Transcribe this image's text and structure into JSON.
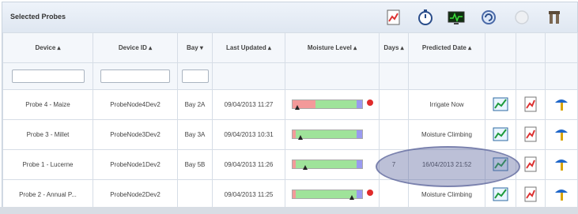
{
  "panel": {
    "title": "Selected Probes"
  },
  "toolbar": {
    "icons": [
      "chart-icon",
      "stopwatch-icon",
      "monitor-icon",
      "refresh-icon",
      "circle-icon",
      "tools-icon"
    ]
  },
  "columns": {
    "device": "Device ▴",
    "device_id": "Device ID ▴",
    "bay": "Bay ▾",
    "last_updated": "Last Updated ▴",
    "moisture": "Moisture Level ▴",
    "days": "Days ▴",
    "predicted": "Predicted Date ▴"
  },
  "rows": [
    {
      "device": "Probe 4 - Maize",
      "device_id": "ProbeNode4Dev2",
      "bay": "Bay 2A",
      "last_updated": "09/04/2013 11:27",
      "days": "",
      "predicted": "Irrigate Now",
      "moisture": {
        "level": 0.07,
        "red_fraction": 0.33,
        "warning": true
      }
    },
    {
      "device": "Probe 3 - Millet",
      "device_id": "ProbeNode3Dev2",
      "bay": "Bay 3A",
      "last_updated": "09/04/2013 10:31",
      "days": "",
      "predicted": "Moisture Climbing",
      "moisture": {
        "level": 0.11,
        "red_fraction": 0.05,
        "warning": false
      }
    },
    {
      "device": "Probe 1 - Lucerne",
      "device_id": "ProbeNode1Dev2",
      "bay": "Bay 5B",
      "last_updated": "09/04/2013 11:26",
      "days": "7",
      "predicted": "16/04/2013 21:52",
      "moisture": {
        "level": 0.18,
        "red_fraction": 0.05,
        "warning": false
      }
    },
    {
      "device": "Probe 2 - Annual P...",
      "device_id": "ProbeNode2Dev2",
      "bay": "",
      "last_updated": "09/04/2013 11:25",
      "days": "",
      "predicted": "Moisture Climbing",
      "moisture": {
        "level": 0.85,
        "red_fraction": 0.05,
        "warning": true
      }
    }
  ],
  "colors": {
    "header_bg": "#dfe7f1",
    "moisture_green": "#9fe39a",
    "moisture_red": "#f39a9a",
    "moisture_blue": "#9a9af0",
    "highlight_oval": "#5f69a0"
  }
}
